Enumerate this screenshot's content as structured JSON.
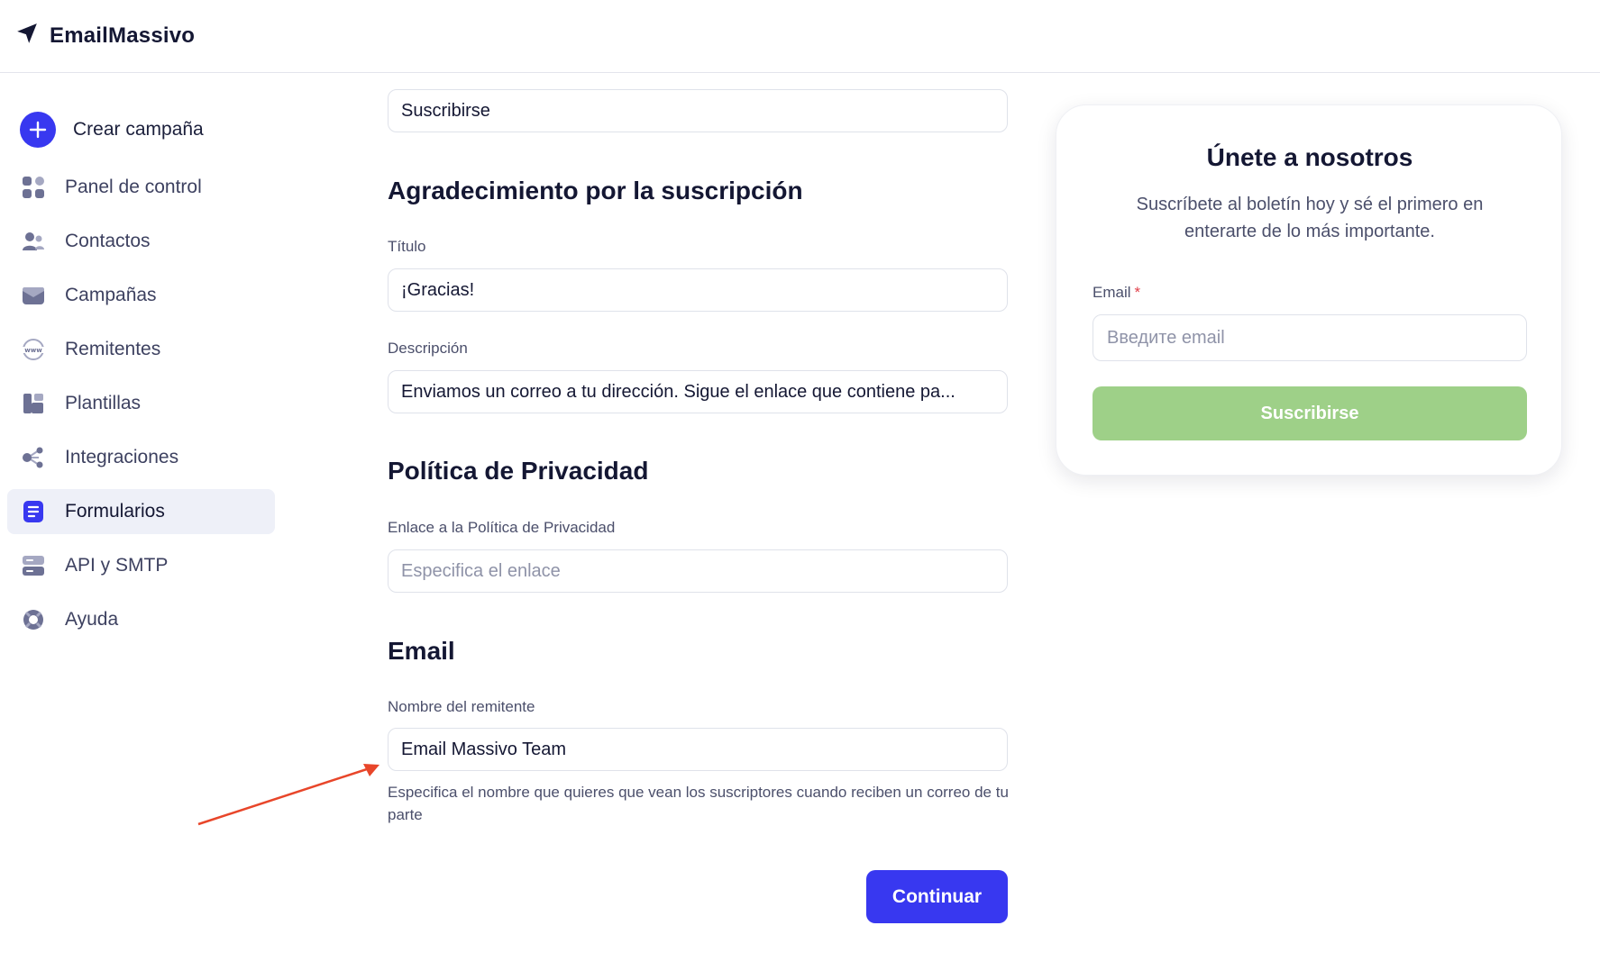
{
  "header": {
    "brand": "EmailMassivo",
    "logo_icon": "paper-plane-icon"
  },
  "sidebar": {
    "create_label": "Crear campaña",
    "accent": "#3838f0",
    "items": [
      {
        "label": "Panel de control",
        "icon": "dashboard-icon",
        "active": false
      },
      {
        "label": "Contactos",
        "icon": "contacts-icon",
        "active": false
      },
      {
        "label": "Campañas",
        "icon": "campaigns-icon",
        "active": false
      },
      {
        "label": "Remitentes",
        "icon": "senders-www-icon",
        "active": false
      },
      {
        "label": "Plantillas",
        "icon": "templates-icon",
        "active": false
      },
      {
        "label": "Integraciones",
        "icon": "integrations-icon",
        "active": false
      },
      {
        "label": "Formularios",
        "icon": "forms-icon",
        "active": true
      },
      {
        "label": "API y SMTP",
        "icon": "server-icon",
        "active": false
      },
      {
        "label": "Ayuda",
        "icon": "lifebuoy-icon",
        "active": false
      }
    ]
  },
  "form": {
    "button_text_value": "Suscribirse",
    "thanks_section_title": "Agradecimiento por la suscripción",
    "title_label": "Título",
    "title_value": "¡Gracias!",
    "description_label": "Descripción",
    "description_value": "Enviamos un correo a tu dirección. Sigue el enlace que contiene pa...",
    "privacy_section_title": "Política de Privacidad",
    "privacy_link_label": "Enlace a la Política de Privacidad",
    "privacy_link_placeholder": "Especifica el enlace",
    "email_section_title": "Email",
    "sender_name_label": "Nombre del remitente",
    "sender_name_value": "Email Massivo Team",
    "sender_name_help": "Especifica el nombre que quieres que vean los suscriptores cuando reciben un correo de tu parte",
    "continue_label": "Continuar"
  },
  "preview": {
    "title": "Únete a nosotros",
    "subtitle": "Suscríbete al boletín hoy y sé el primero en enterarte de lo más importante.",
    "email_label": "Email",
    "required_mark": "*",
    "email_placeholder": "Введите email",
    "button_label": "Suscribirse",
    "button_color": "#9ed088"
  },
  "annotation": {
    "arrow_color": "#e8462a"
  }
}
